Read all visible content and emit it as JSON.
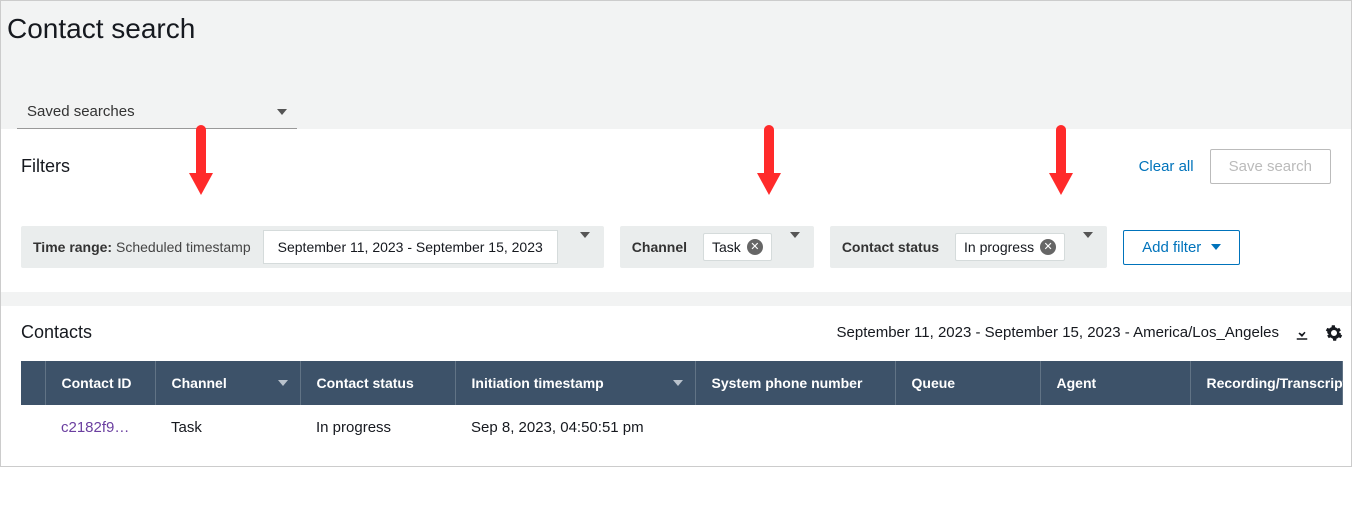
{
  "page": {
    "title": "Contact search",
    "saved_searches_label": "Saved searches"
  },
  "filters": {
    "section_label": "Filters",
    "clear_all": "Clear all",
    "save_search": "Save search",
    "add_filter": "Add filter",
    "time_range": {
      "label": "Time range:",
      "sublabel": "Scheduled timestamp",
      "value": "September 11, 2023 - September 15, 2023"
    },
    "channel": {
      "label": "Channel",
      "chips": [
        "Task"
      ]
    },
    "contact_status": {
      "label": "Contact status",
      "chips": [
        "In progress"
      ]
    }
  },
  "contacts": {
    "section_label": "Contacts",
    "range_tz": "September 11, 2023 - September 15, 2023 - America/Los_Angeles",
    "columns": {
      "contact_id": "Contact ID",
      "channel": "Channel",
      "contact_status": "Contact status",
      "initiation_ts": "Initiation timestamp",
      "system_phone": "System phone number",
      "queue": "Queue",
      "agent": "Agent",
      "recording": "Recording/Transcript"
    },
    "rows": [
      {
        "contact_id": "c2182f9…",
        "channel": "Task",
        "contact_status": "In progress",
        "initiation_ts": "Sep 8, 2023, 04:50:51 pm",
        "system_phone": "",
        "queue": "",
        "agent": "",
        "recording": ""
      }
    ]
  },
  "icons": {
    "download": "download-icon",
    "settings": "gear-icon"
  }
}
